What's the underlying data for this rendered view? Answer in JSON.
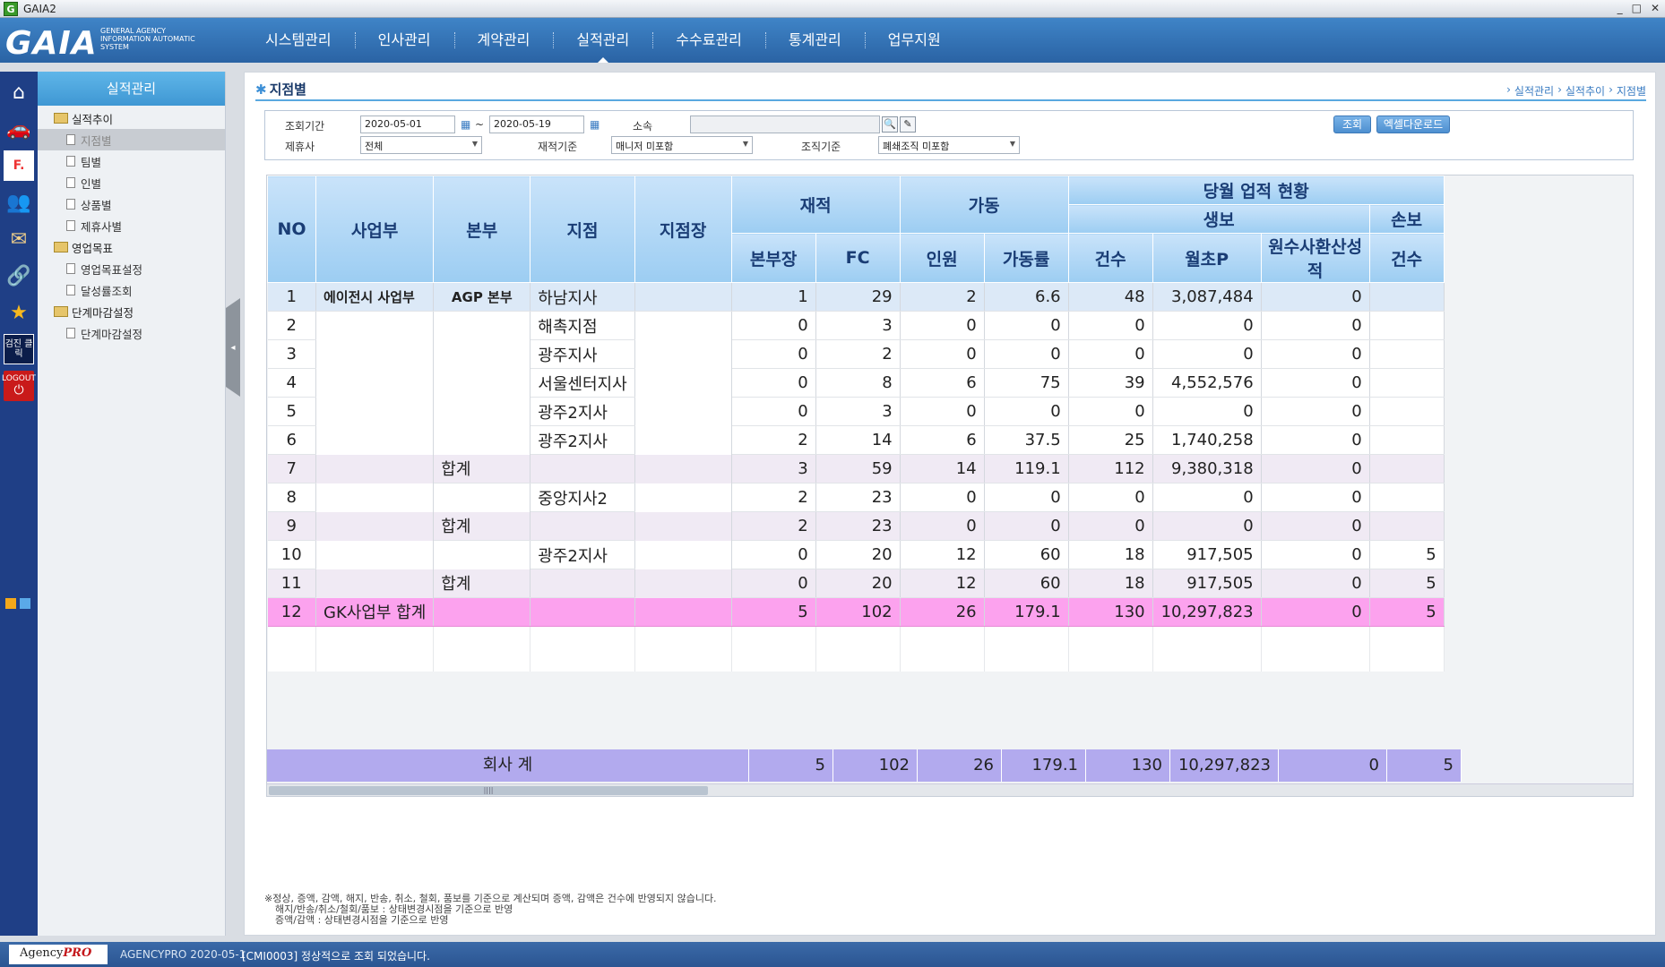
{
  "window": {
    "title": "GAIA2",
    "app_icon": "G",
    "controls": [
      "_",
      "□",
      "✕"
    ]
  },
  "logo": {
    "text": "GAIA",
    "subtitle": "GENERAL AGENCY INFORMATION AUTOMATIC SYSTEM"
  },
  "nav": [
    "시스템관리",
    "인사관리",
    "계약관리",
    "실적관리",
    "수수료관리",
    "통계관리",
    "업무지원"
  ],
  "nav_active": "실적관리",
  "iconbar": {
    "icons": [
      "home-icon",
      "car-icon",
      "fm-icon",
      "people-icon",
      "mail-icon",
      "link-icon",
      "star-icon"
    ],
    "checkup_label": "검진 클릭",
    "logout_label": "LOGOUT"
  },
  "sidebar": {
    "title": "실적관리",
    "groups": [
      {
        "label": "실적추이",
        "items": [
          "지점별",
          "팀별",
          "인별",
          "상품별",
          "제휴사별"
        ]
      },
      {
        "label": "영업목표",
        "items": [
          "영업목표설정",
          "달성률조회"
        ]
      },
      {
        "label": "단계마감설정",
        "items": [
          "단계마감설정"
        ]
      }
    ],
    "selected": "지점별"
  },
  "page": {
    "title": "지점별",
    "breadcrumb": [
      "실적관리",
      "실적추이",
      "지점별"
    ]
  },
  "filters": {
    "period_label": "조회기간",
    "date_from": "2020-05-01",
    "date_tilde": "~",
    "date_to": "2020-05-19",
    "affil_label": "소속",
    "affil_value": "",
    "partner_label": "제휴사",
    "partner_value": "전체",
    "basis_label": "재적기준",
    "basis_value": "매니저 미포함",
    "org_label": "조직기준",
    "org_value": "폐쇄조직 미포함",
    "search_button": "조회",
    "excel_button": "엑셀다운로드"
  },
  "grid": {
    "headers": {
      "no": "NO",
      "division": "사업부",
      "hq": "본부",
      "branch": "지점",
      "branch_mgr": "지점장",
      "enrolled": "재적",
      "active": "가동",
      "monthly": "당월 업적 현황",
      "life": "생보",
      "nonlife": "손보",
      "hq_mgr": "본부장",
      "fc": "FC",
      "people": "인원",
      "rate": "가동률",
      "count": "건수",
      "initial_p": "월초P",
      "converted": "원수사환산성적",
      "nl_count": "건수"
    },
    "rows": [
      {
        "no": "1",
        "division": "에이전시 사업부",
        "hq": "AGP 본부",
        "branch": "하남지사",
        "hq_mgr": "1",
        "fc": "29",
        "people": "2",
        "rate": "6.6",
        "count": "48",
        "initial_p": "3,087,484",
        "converted": "0",
        "nl_count": ""
      },
      {
        "no": "2",
        "division": "",
        "hq": "",
        "branch": "해촉지점",
        "hq_mgr": "0",
        "fc": "3",
        "people": "0",
        "rate": "0",
        "count": "0",
        "initial_p": "0",
        "converted": "0",
        "nl_count": ""
      },
      {
        "no": "3",
        "division": "",
        "hq": "",
        "branch": "광주지사",
        "hq_mgr": "0",
        "fc": "2",
        "people": "0",
        "rate": "0",
        "count": "0",
        "initial_p": "0",
        "converted": "0",
        "nl_count": ""
      },
      {
        "no": "4",
        "division": "",
        "hq": "",
        "branch": "서울센터지사",
        "hq_mgr": "0",
        "fc": "8",
        "people": "6",
        "rate": "75",
        "count": "39",
        "initial_p": "4,552,576",
        "converted": "0",
        "nl_count": ""
      },
      {
        "no": "5",
        "division": "",
        "hq": "",
        "branch": "광주2지사",
        "hq_mgr": "0",
        "fc": "3",
        "people": "0",
        "rate": "0",
        "count": "0",
        "initial_p": "0",
        "converted": "0",
        "nl_count": ""
      },
      {
        "no": "6",
        "division": "",
        "hq": "",
        "branch": "광주2지사",
        "hq_mgr": "2",
        "fc": "14",
        "people": "6",
        "rate": "37.5",
        "count": "25",
        "initial_p": "1,740,258",
        "converted": "0",
        "nl_count": ""
      },
      {
        "no": "7",
        "division": "",
        "hq": "합계",
        "branch": "",
        "hq_mgr": "3",
        "fc": "59",
        "people": "14",
        "rate": "119.1",
        "count": "112",
        "initial_p": "9,380,318",
        "converted": "0",
        "nl_count": ""
      },
      {
        "no": "8",
        "division": "",
        "hq": "",
        "branch": "중앙지사2",
        "hq_mgr": "2",
        "fc": "23",
        "people": "0",
        "rate": "0",
        "count": "0",
        "initial_p": "0",
        "converted": "0",
        "nl_count": ""
      },
      {
        "no": "9",
        "division": "",
        "hq": "합계",
        "branch": "",
        "hq_mgr": "2",
        "fc": "23",
        "people": "0",
        "rate": "0",
        "count": "0",
        "initial_p": "0",
        "converted": "0",
        "nl_count": ""
      },
      {
        "no": "10",
        "division": "",
        "hq": "",
        "branch": "광주2지사",
        "hq_mgr": "0",
        "fc": "20",
        "people": "12",
        "rate": "60",
        "count": "18",
        "initial_p": "917,505",
        "converted": "0",
        "nl_count": "5"
      },
      {
        "no": "11",
        "division": "",
        "hq": "합계",
        "branch": "",
        "hq_mgr": "0",
        "fc": "20",
        "people": "12",
        "rate": "60",
        "count": "18",
        "initial_p": "917,505",
        "converted": "0",
        "nl_count": "5"
      },
      {
        "no": "12",
        "division": "GK사업부 합계",
        "hq": "",
        "branch": "",
        "hq_mgr": "5",
        "fc": "102",
        "people": "26",
        "rate": "179.1",
        "count": "130",
        "initial_p": "10,297,823",
        "converted": "0",
        "nl_count": "5"
      }
    ],
    "footer": {
      "label": "회사 계",
      "hq_mgr": "5",
      "fc": "102",
      "people": "26",
      "rate": "179.1",
      "count": "130",
      "initial_p": "10,297,823",
      "converted": "0",
      "nl_count": "5"
    }
  },
  "notes": [
    "※정상, 증액, 감액, 해지, 반송, 취소, 철회, 품보를 기준으로 계산되며 증액, 감액은 건수에 반영되지 않습니다.",
    "해지/반송/취소/철회/품보 : 상태변경시점을 기준으로 반영",
    "증액/감액 : 상태변경시점을 기준으로 반영"
  ],
  "status": {
    "brand": "Agency",
    "brand_suffix": "PRO",
    "system": "AGENCYPRO 2020-05-1",
    "message": "[CMI0003] 정상적으로 조회 되었습니다."
  },
  "colors": {
    "header_blue": "#2a63a4",
    "grid_header": "#9ccdf2",
    "total_pink": "#fca2ee",
    "footer_violet": "#b2aaee",
    "subtotal": "#f0eaf4"
  }
}
